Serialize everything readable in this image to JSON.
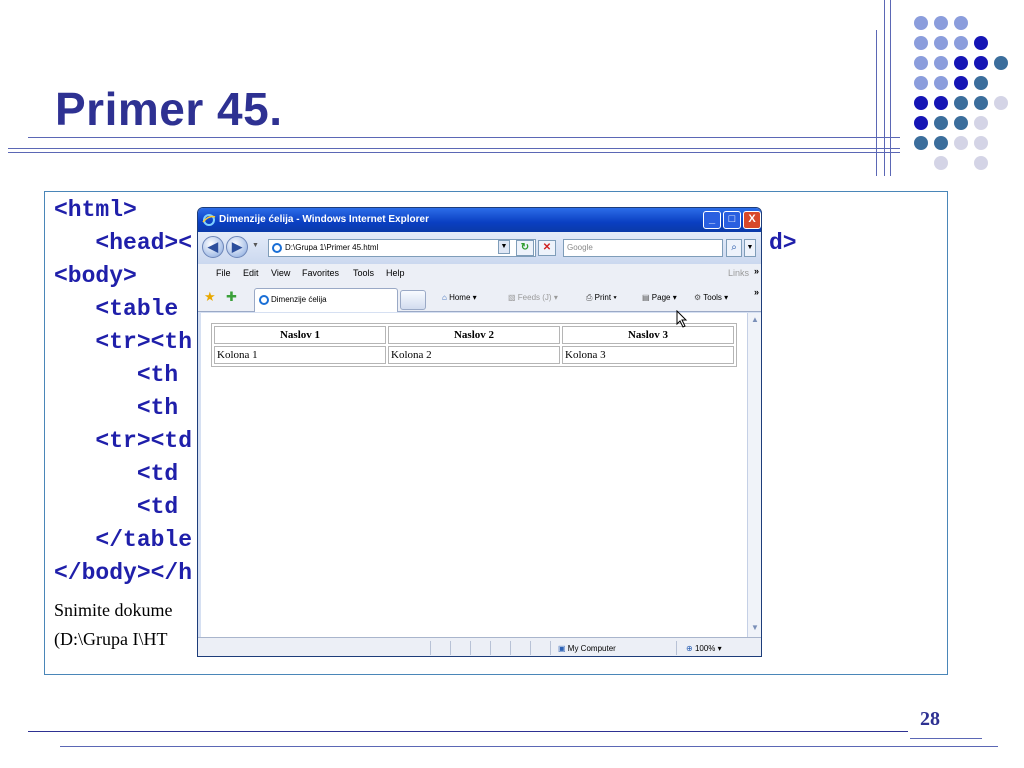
{
  "slide": {
    "title": "Primer 45.",
    "page_number": "28",
    "code_lines": [
      "<html>",
      "   <head><",
      "<body>",
      "   <table ",
      "   <tr><th",
      "      <th",
      "      <th",
      "   <tr><td",
      "      <td",
      "      <td",
      "   </table",
      "</body></h"
    ],
    "code_right_fragment": "d>",
    "note_lines": [
      "Snimite dokume",
      "(D:\\Grupa I\\HT"
    ]
  },
  "browser": {
    "window_title": "Dimenzije ćelija - Windows Internet Explorer",
    "controls": {
      "minimize": "_",
      "maximize": "□",
      "close": "X"
    },
    "address": "D:\\Grupa 1\\Primer 45.html",
    "search_placeholder": "Google",
    "menu": [
      "File",
      "Edit",
      "View",
      "Favorites",
      "Tools",
      "Help"
    ],
    "links_label": "Links",
    "tab_title": "Dimenzije ćelija",
    "toolbar": {
      "home": "Home",
      "feeds": "Feeds (J)",
      "print": "Print",
      "page": "Page",
      "tools": "Tools"
    },
    "table": {
      "headers": [
        "Naslov 1",
        "Naslov 2",
        "Naslov 3"
      ],
      "row": [
        "Kolona 1",
        "Kolona 2",
        "Kolona 3"
      ]
    },
    "status": {
      "zone": "My Computer",
      "zoom": "100%"
    }
  },
  "colors": {
    "title": "#2e3192",
    "code": "#1f1faa",
    "titlebar": "#0a3fc2",
    "dot_light": "#8b9ddc",
    "dot_dark": "#1515b5",
    "dot_steel": "#3b6e9c",
    "dot_pale": "#d4d4e6"
  }
}
